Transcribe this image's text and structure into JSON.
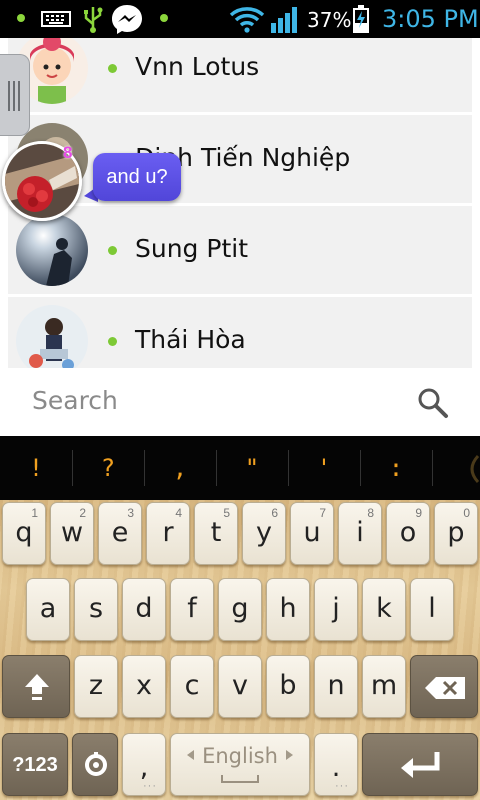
{
  "status_bar": {
    "battery_percent": "37%",
    "time": "3:05 PM",
    "icons": [
      "notification-dot-icon",
      "keyboard-icon",
      "usb-icon",
      "messenger-icon",
      "notification-dot-icon",
      "wifi-icon",
      "signal-icon",
      "battery-charging-icon"
    ]
  },
  "contacts": [
    {
      "name": "Vnn Lotus",
      "online": true
    },
    {
      "name": "Định Tiến Nghiệp",
      "online": true
    },
    {
      "name": "Sung Ptit",
      "online": true
    },
    {
      "name": "Thái Hòa",
      "online": true
    }
  ],
  "chat_head": {
    "badge_count": "8",
    "message": "and u?"
  },
  "search": {
    "placeholder": "Search"
  },
  "suggestions": [
    "!",
    "?",
    ",",
    "\"",
    "'",
    ":"
  ],
  "keyboard": {
    "row1": [
      {
        "char": "q",
        "num": "1"
      },
      {
        "char": "w",
        "num": "2"
      },
      {
        "char": "e",
        "num": "3"
      },
      {
        "char": "r",
        "num": "4"
      },
      {
        "char": "t",
        "num": "5"
      },
      {
        "char": "y",
        "num": "6"
      },
      {
        "char": "u",
        "num": "7"
      },
      {
        "char": "i",
        "num": "8"
      },
      {
        "char": "o",
        "num": "9"
      },
      {
        "char": "p",
        "num": "0"
      }
    ],
    "row2": [
      "a",
      "s",
      "d",
      "f",
      "g",
      "h",
      "j",
      "k",
      "l"
    ],
    "row3": [
      "z",
      "x",
      "c",
      "v",
      "b",
      "n",
      "m"
    ],
    "symbols_label": "?123",
    "comma": ",",
    "space_language": "English",
    "period": "."
  },
  "colors": {
    "online": "#7dc935",
    "time": "#3fb6e6",
    "suggestion": "#f0a020",
    "chat_bubble": "#5a4fe6"
  }
}
